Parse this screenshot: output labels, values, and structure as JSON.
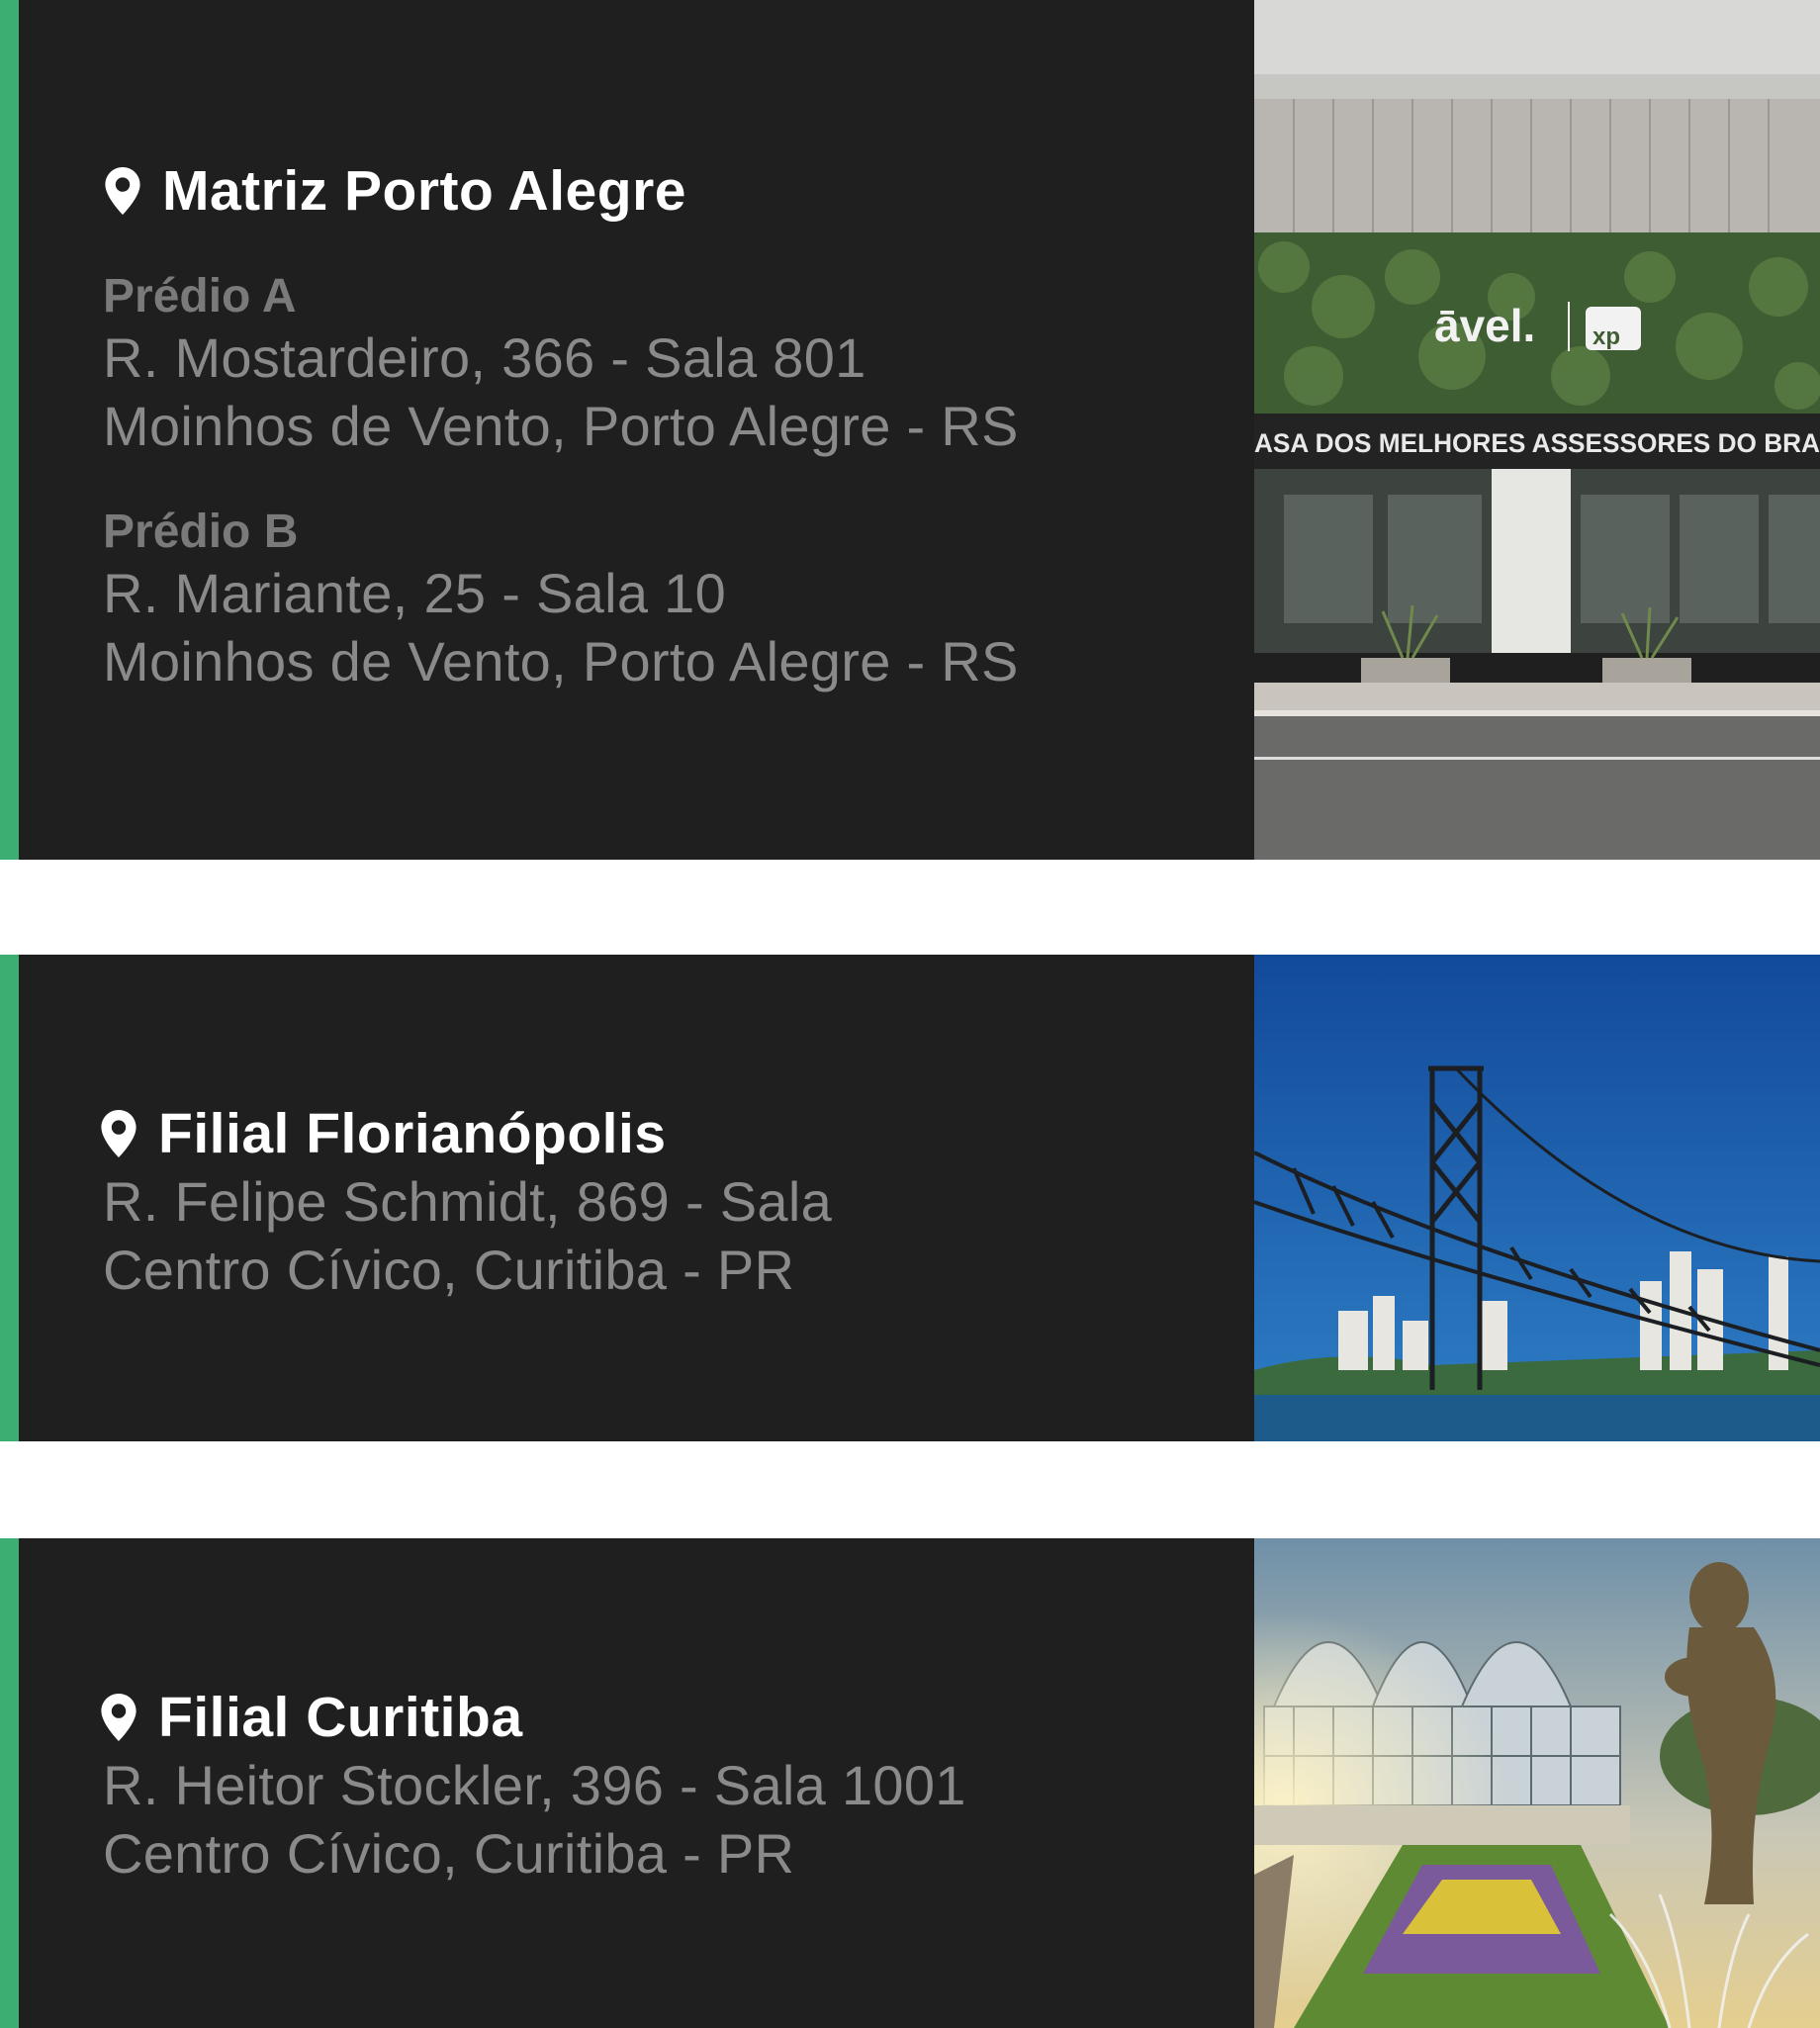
{
  "colors": {
    "card_background": "#1f1f1f",
    "accent": "#3dae72",
    "title": "#ffffff",
    "subtitle": "#7a7a7a",
    "address": "#8a8a8a"
  },
  "locations": [
    {
      "icon": "location-pin-icon",
      "title": "Matriz Porto Alegre",
      "buildings": [
        {
          "label": "Prédio A",
          "line1": "R. Mostardeiro, 366 - Sala 801",
          "line2": "Moinhos de Vento, Porto Alegre - RS"
        },
        {
          "label": "Prédio B",
          "line1": "R. Mariante, 25 - Sala 10",
          "line2": "Moinhos de Vento, Porto Alegre - RS"
        }
      ],
      "photo": {
        "logo_text": "āvel.",
        "logo_badge": "xp",
        "sign_text": "ASA DOS MELHORES ASSESSORES DO BRA"
      }
    },
    {
      "icon": "location-pin-icon",
      "title": "Filial Florianópolis",
      "line1": "R. Felipe Schmidt, 869 - Sala",
      "line2": "Centro Cívico, Curitiba - PR"
    },
    {
      "icon": "location-pin-icon",
      "title": "Filial Curitiba",
      "line1": "R. Heitor Stockler, 396 - Sala 1001",
      "line2": "Centro Cívico, Curitiba - PR"
    }
  ]
}
